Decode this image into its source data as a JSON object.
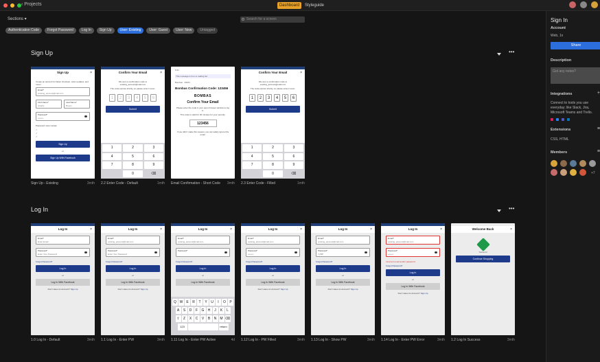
{
  "topbar": {
    "back_label": "Projects",
    "dashboard_label": "Dashboard",
    "styleguide_label": "Styleguide"
  },
  "filters": {
    "sections_label": "Sections",
    "search_placeholder": "Search for a screen",
    "chips": [
      "Authentication Code",
      "Forgot Password",
      "Log In",
      "Sign Up",
      "User: Existing",
      "User: Guest",
      "User: New",
      "Untagged"
    ]
  },
  "sections": [
    {
      "title": "Sign Up",
      "screens": [
        {
          "caption": "Sign Up - Existing",
          "time": "3mth"
        },
        {
          "caption": "2.2 Enter Code - Default",
          "time": "1mth"
        },
        {
          "caption": "Email Confirmation - Short Code",
          "time": "3mth"
        },
        {
          "caption": "2.3 Enter Code - Filled",
          "time": "1mth"
        }
      ]
    },
    {
      "title": "Log In",
      "screens": [
        {
          "caption": "1.0 Log In - Default",
          "time": "3mth"
        },
        {
          "caption": "1.1 Log In - Enter PW",
          "time": "3mth"
        },
        {
          "caption": "1.11 Log In - Enter PW Active",
          "time": "4d"
        },
        {
          "caption": "1.12 Log In - PW Filled",
          "time": "3mth"
        },
        {
          "caption": "1.13 Log In - Show PW",
          "time": "3mth"
        },
        {
          "caption": "1.14 Log In - Enter PW Error",
          "time": "3mth"
        },
        {
          "caption": "1.2 Log In Success",
          "time": "3mth"
        }
      ]
    }
  ],
  "mock": {
    "sign_up_title": "Sign Up",
    "sign_up_intro": "Create an account for faster checkout, order updates, and more!",
    "email_label": "Email*",
    "email_value": "existing_account@mail.com",
    "email_placeholder": "Enter Email",
    "first_name_label": "First Name*",
    "first_name_value": "Charlie",
    "last_name_label": "Last Name*",
    "last_name_value": "Brown",
    "password_label": "Password*",
    "password_placeholder": "Enter Your Password",
    "password_dots": "••••••••",
    "password_shown": "7y!BP",
    "pw_rules": "Password must contain",
    "sign_up_button": "Sign Up",
    "or": "or",
    "facebook_signup": "Sign Up With Facebook",
    "confirm_email_title": "Confirm Your Email",
    "confirm_body": "We sent a confirmation code to existing_account@mail.com",
    "confirm_expire": "The code expires shortly, so please enter it soon.",
    "code_digits": [
      "1",
      "2",
      "3",
      "4",
      "5",
      "6"
    ],
    "submit_button": "Submit",
    "keypad": [
      "1",
      "2",
      "3",
      "4",
      "5",
      "6",
      "7",
      "8",
      "9",
      "",
      "0",
      "⌫"
    ],
    "email_time": "9:41",
    "email_banner": "This message is from a mailing list.",
    "email_sender": "Bombas",
    "email_date": "2/8/21",
    "email_subject": "Bombas Confirmation Code: 123456",
    "email_brand": "BOMBAS",
    "email_confirm_heading": "Confirm Your Email",
    "email_instructions": "Please enter the code in your open browser window to log in.",
    "email_valid": "This code is valid for 30 minutes for your security.",
    "email_code": "123456",
    "email_footer": "If you didn't make this request, you can safely ignore this email.",
    "log_in_title": "Log In",
    "forgot_password": "Forgot Password?",
    "log_in_button": "Log In",
    "facebook_login": "Log In With Facebook",
    "no_account": "Don't Have An Account?",
    "sign_up_link": "Sign Up",
    "error_text": "Incorrect email and/or password",
    "welcome_title": "Welcome Back",
    "youre_in": "You're in!",
    "continue_button": "Continue Shopping",
    "qwerty_rows": [
      [
        "Q",
        "W",
        "E",
        "R",
        "T",
        "Y",
        "U",
        "I",
        "O",
        "P"
      ],
      [
        "A",
        "S",
        "D",
        "F",
        "G",
        "H",
        "J",
        "K",
        "L"
      ],
      [
        "⇧",
        "Z",
        "X",
        "C",
        "V",
        "B",
        "N",
        "M",
        "⌫"
      ]
    ],
    "kbd_123": "123",
    "kbd_return": "return"
  },
  "panel": {
    "title": "Sign In",
    "account_label": "Account",
    "account_value": "Web, 1x",
    "share_button": "Share",
    "description_label": "Description",
    "notes_placeholder": "Got any notes?",
    "integrations_label": "Integrations",
    "integrations_text": "Connect to tools you use everyday; like Slack, Jira, Microsoft Teams and Trello.",
    "extensions_label": "Extensions",
    "extensions_value": "CSS, HTML",
    "members_label": "Members",
    "more_members": "+7"
  }
}
